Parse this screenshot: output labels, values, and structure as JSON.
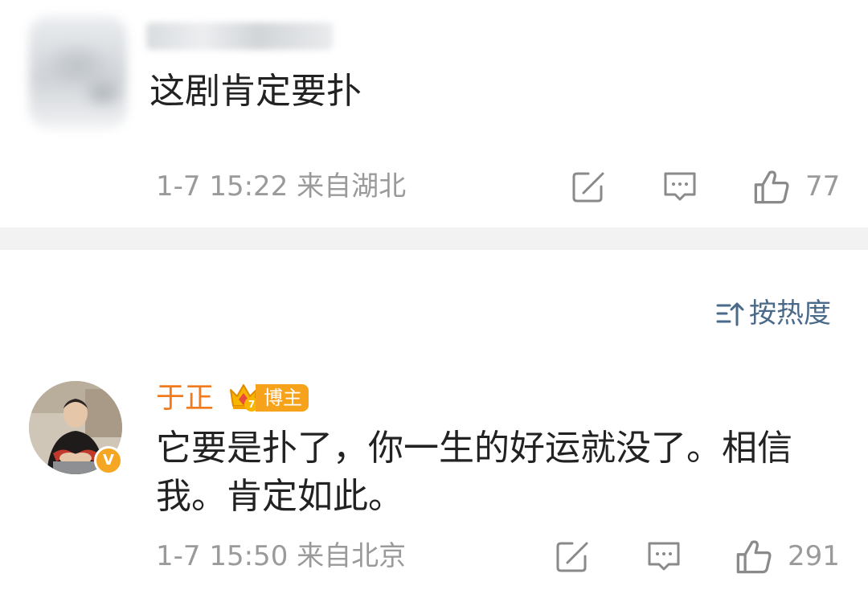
{
  "comments": [
    {
      "author": "",
      "text": "这剧肯定要扑",
      "time": "1-7 15:22",
      "location": "来自湖北",
      "likes": "77"
    },
    {
      "author": "于正",
      "badge": "博主",
      "crown_level": "7",
      "verified_mark": "V",
      "text": "它要是扑了，你一生的好运就没了。相信我。肯定如此。",
      "time": "1-7 15:50",
      "location": "来自北京",
      "likes": "291"
    }
  ],
  "sort": {
    "label": "按热度",
    "icon": "sort-icon"
  },
  "icons": {
    "share": "share-icon",
    "reply": "comment-icon",
    "like": "thumbs-up-icon"
  },
  "colors": {
    "author_name": "#f07a1c",
    "badge": "#f7a21b",
    "sort_link": "#4a6a8a",
    "meta_text": "#9a9a9a",
    "divider": "#f2f2f2"
  }
}
